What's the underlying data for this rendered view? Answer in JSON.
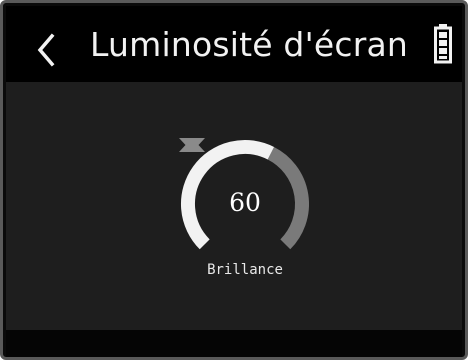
{
  "header": {
    "title": "Luminosité d'écran",
    "back_icon": "chevron-left-icon",
    "battery_icon": "battery-icon"
  },
  "brightness": {
    "value": "60",
    "label": "Brillance",
    "level_percent": 60,
    "up_icon": "triangle-up-icon",
    "down_icon": "triangle-down-icon"
  },
  "colors": {
    "header_bg": "#000000",
    "content_bg": "#1e1e1e",
    "arc_active": "#f2f2f2",
    "arc_inactive": "#7a7a7a",
    "arrow": "#8a8a8a"
  }
}
